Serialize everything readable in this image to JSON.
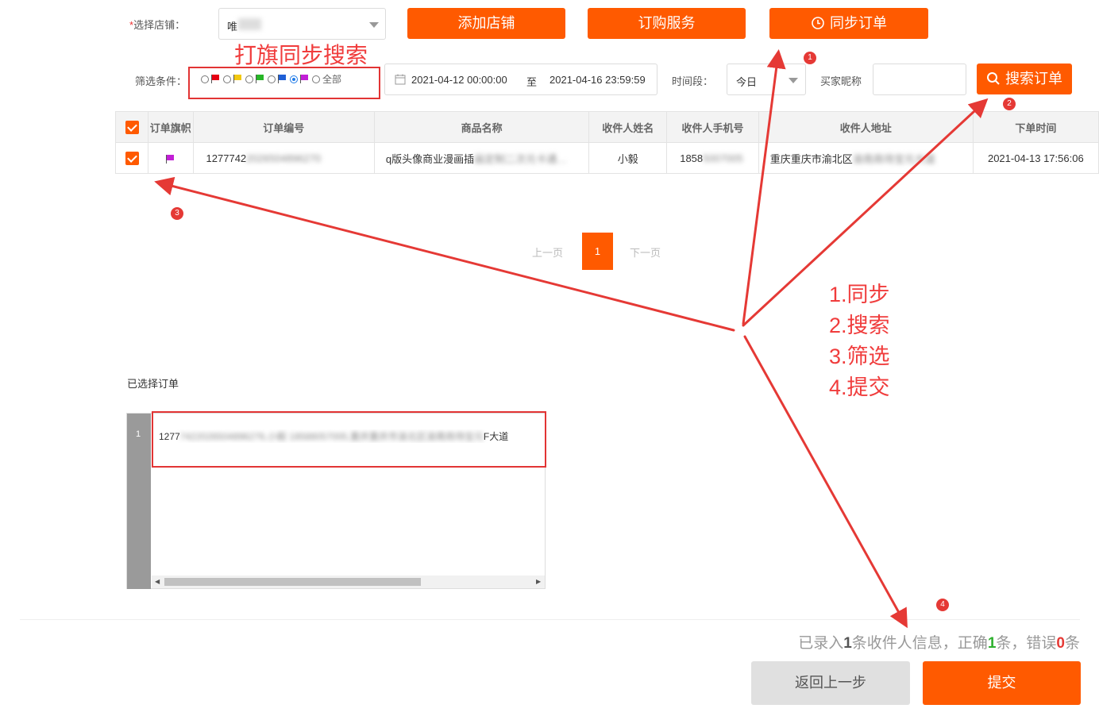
{
  "store": {
    "required_mark": "*",
    "label": "选择店铺：",
    "value_visible": "唯",
    "value_blurred": "        "
  },
  "buttons": {
    "add_store": "添加店铺",
    "order_service": "订购服务",
    "sync_orders": "同步订单",
    "search_orders": "搜索订单"
  },
  "annotation_flag_search": "打旗同步搜索",
  "filter": {
    "label": "筛选条件：",
    "flags": [
      {
        "color": "#e60012",
        "selected": false
      },
      {
        "color": "#f2c811",
        "selected": false
      },
      {
        "color": "#27b627",
        "selected": false
      },
      {
        "color": "#1f5fd6",
        "selected": false
      },
      {
        "color": "#c21fd6",
        "selected": true
      }
    ],
    "all_label": "全部"
  },
  "date_range": {
    "start": "2021-04-12 00:00:00",
    "separator": "至",
    "end": "2021-04-16 23:59:59"
  },
  "period": {
    "label": "时间段：",
    "value": "今日"
  },
  "buyer": {
    "label": "买家昵称",
    "value": ""
  },
  "table": {
    "headers": [
      "订单旗帜",
      "订单编号",
      "商品名称",
      "收件人姓名",
      "收件人手机号",
      "收件人地址",
      "下单时间"
    ],
    "rows": [
      {
        "flag_color": "#c21fd6",
        "order_no": "1277742",
        "order_no_blur": "2026504896270",
        "product": "q版头像商业漫画插",
        "product_blur": "画定制二次元卡通…",
        "name": "小毅",
        "phone": "1858",
        "phone_blur": "5007005",
        "address": "重庆重庆市渝北区",
        "address_blur": "渝南商场宝元大道",
        "time": "2021-04-13 17:56:06"
      }
    ]
  },
  "pagination": {
    "prev": "上一页",
    "current": "1",
    "next": "下一页"
  },
  "selected_label": "已选择订单",
  "editor": {
    "line_no": "1",
    "text_visible": "1277",
    "text_blur": "7422026504896276,小毅 18588057005,重庆重庆市渝北区渝南商场宝元",
    "text_tail": "F大道"
  },
  "status": {
    "prefix": "已录入",
    "count": "1",
    "mid1": "条收件人信息，正确",
    "correct": "1",
    "mid2": "条，错误",
    "error": "0",
    "suffix": "条"
  },
  "footer": {
    "back": "返回上一步",
    "submit": "提交"
  },
  "steps": [
    "1.同步",
    "2.搜索",
    "3.筛选",
    "4.提交"
  ],
  "markers": [
    "1",
    "2",
    "3",
    "4"
  ],
  "colors": {
    "accent": "#ff5a00",
    "annotation": "#e53935",
    "correct": "#2fb12f",
    "error": "#e53935"
  }
}
